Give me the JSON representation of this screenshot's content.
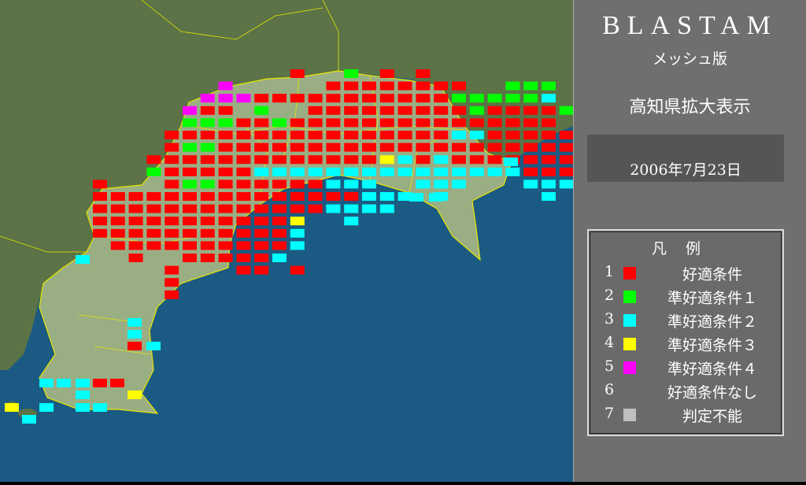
{
  "header": {
    "title": "BLASTAM",
    "subtitle": "メッシュ版"
  },
  "region_label": "高知県拡大表示",
  "date": "2006年7月23日",
  "legend": {
    "title": "凡例",
    "items": [
      {
        "num": "1",
        "label": "好適条件",
        "color": "#ff0000"
      },
      {
        "num": "2",
        "label": "準好適条件１",
        "color": "#00ff00"
      },
      {
        "num": "3",
        "label": "準好適条件２",
        "color": "#00ffff"
      },
      {
        "num": "4",
        "label": "準好適条件３",
        "color": "#ffff00"
      },
      {
        "num": "5",
        "label": "準好適条件４",
        "color": "#ff00ff"
      },
      {
        "num": "6",
        "label": "好適条件なし",
        "color": ""
      },
      {
        "num": "7",
        "label": "判定不能",
        "color": "#c0c0c0"
      }
    ]
  },
  "map": {
    "sea_color": "#1b5a82",
    "land_color": "#5b7346",
    "prefecture_color": "#9aae84",
    "border_color": "#e6e600"
  }
}
